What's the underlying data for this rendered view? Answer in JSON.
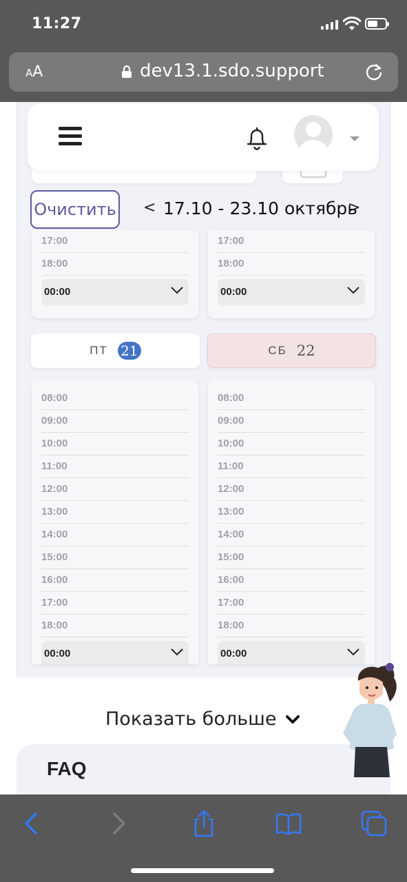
{
  "status_bar": {
    "time": "11:27"
  },
  "browser": {
    "text_size_label": "AA",
    "url": "dev13.1.sdo.support"
  },
  "schedule": {
    "clear_button": "Очистить",
    "prev_symbol": "<",
    "next_symbol": ">",
    "week_range": "17.10 - 23.10 октябрь",
    "top_panels": {
      "slots": [
        "17:00",
        "18:00"
      ],
      "selected_value": "00:00"
    },
    "days": [
      {
        "name": "ПТ",
        "number": "21",
        "highlighted": false,
        "today": true,
        "bg_color": "#ffffff"
      },
      {
        "name": "СБ",
        "number": "22",
        "highlighted": true,
        "today": false,
        "bg_color": "#f4e3e3"
      }
    ],
    "time_slots": [
      "08:00",
      "09:00",
      "10:00",
      "11:00",
      "12:00",
      "13:00",
      "14:00",
      "15:00",
      "16:00",
      "17:00",
      "18:00"
    ],
    "selected_value": "00:00"
  },
  "show_more_label": "Показать больше",
  "faq_title": "FAQ",
  "colors": {
    "accent": "#5d5a9c",
    "badge": "#4474c4",
    "browser_chrome": "#585858",
    "toolbar_icon": "#3478f6"
  },
  "icons": [
    "menu-icon",
    "bell-icon",
    "avatar",
    "chevron-down-icon",
    "lock-icon",
    "reload-icon",
    "back-icon",
    "forward-icon",
    "share-icon",
    "bookmarks-icon",
    "tabs-icon"
  ]
}
